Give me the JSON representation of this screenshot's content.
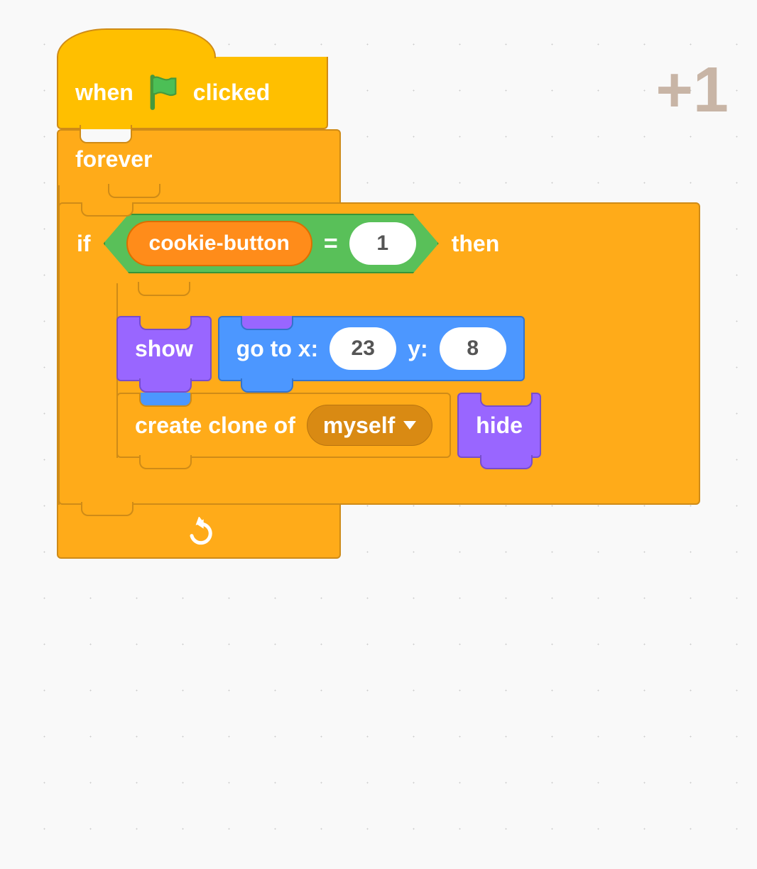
{
  "overlay": {
    "text": "+1"
  },
  "hat": {
    "when": "when",
    "clicked": "clicked",
    "icon": "flag-icon"
  },
  "forever": {
    "label": "forever",
    "loop_icon": "loop-arrow-icon"
  },
  "ifblock": {
    "if": "if",
    "then": "then",
    "condition": {
      "variable": "cookie-button",
      "operator": "=",
      "value": "1"
    }
  },
  "show": {
    "label": "show"
  },
  "goto": {
    "prefix": "go to x:",
    "x": "23",
    "mid": "y:",
    "y": "8"
  },
  "clone": {
    "prefix": "create clone of",
    "target": "myself"
  },
  "hide": {
    "label": "hide"
  }
}
